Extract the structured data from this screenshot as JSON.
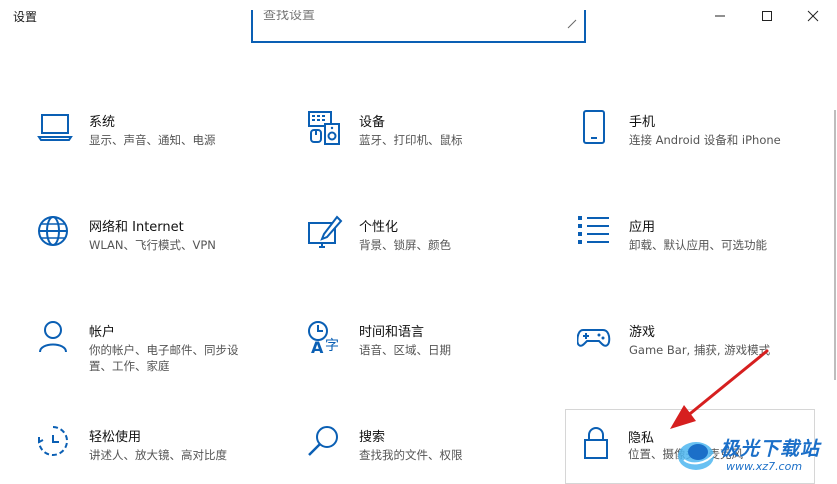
{
  "window": {
    "title": "设置",
    "minimize_icon": "minimize-icon",
    "maximize_icon": "maximize-icon",
    "close_icon": "close-icon"
  },
  "search": {
    "value": "查找设置"
  },
  "tiles": [
    {
      "title": "系统",
      "desc": "显示、声音、通知、电源",
      "icon": "laptop-icon"
    },
    {
      "title": "设备",
      "desc": "蓝牙、打印机、鼠标",
      "icon": "devices-icon"
    },
    {
      "title": "手机",
      "desc": "连接 Android 设备和 iPhone",
      "icon": "phone-icon"
    },
    {
      "title": "网络和 Internet",
      "desc": "WLAN、飞行模式、VPN",
      "icon": "globe-icon"
    },
    {
      "title": "个性化",
      "desc": "背景、锁屏、颜色",
      "icon": "personalization-icon"
    },
    {
      "title": "应用",
      "desc": "卸载、默认应用、可选功能",
      "icon": "apps-list-icon"
    },
    {
      "title": "帐户",
      "desc": "你的帐户、电子邮件、同步设置、工作、家庭",
      "icon": "person-icon"
    },
    {
      "title": "时间和语言",
      "desc": "语音、区域、日期",
      "icon": "time-language-icon"
    },
    {
      "title": "游戏",
      "desc": "Game Bar, 捕获, 游戏模式",
      "icon": "gamepad-icon"
    },
    {
      "title": "轻松使用",
      "desc": "讲述人、放大镜、高对比度",
      "icon": "ease-of-access-icon"
    },
    {
      "title": "搜索",
      "desc": "查找我的文件、权限",
      "icon": "search-icon"
    },
    {
      "title": "隐私",
      "desc": "位置、摄像头、麦克风",
      "icon": "lock-icon"
    }
  ],
  "annotation": {
    "arrow_color": "#d61f1f",
    "arrow_icon": "red-arrow-icon"
  },
  "watermark": {
    "name": "极光下载站",
    "url": "www.xz7.com"
  },
  "colors": {
    "accent": "#0a5fb4",
    "icon": "#0a5fb4"
  }
}
